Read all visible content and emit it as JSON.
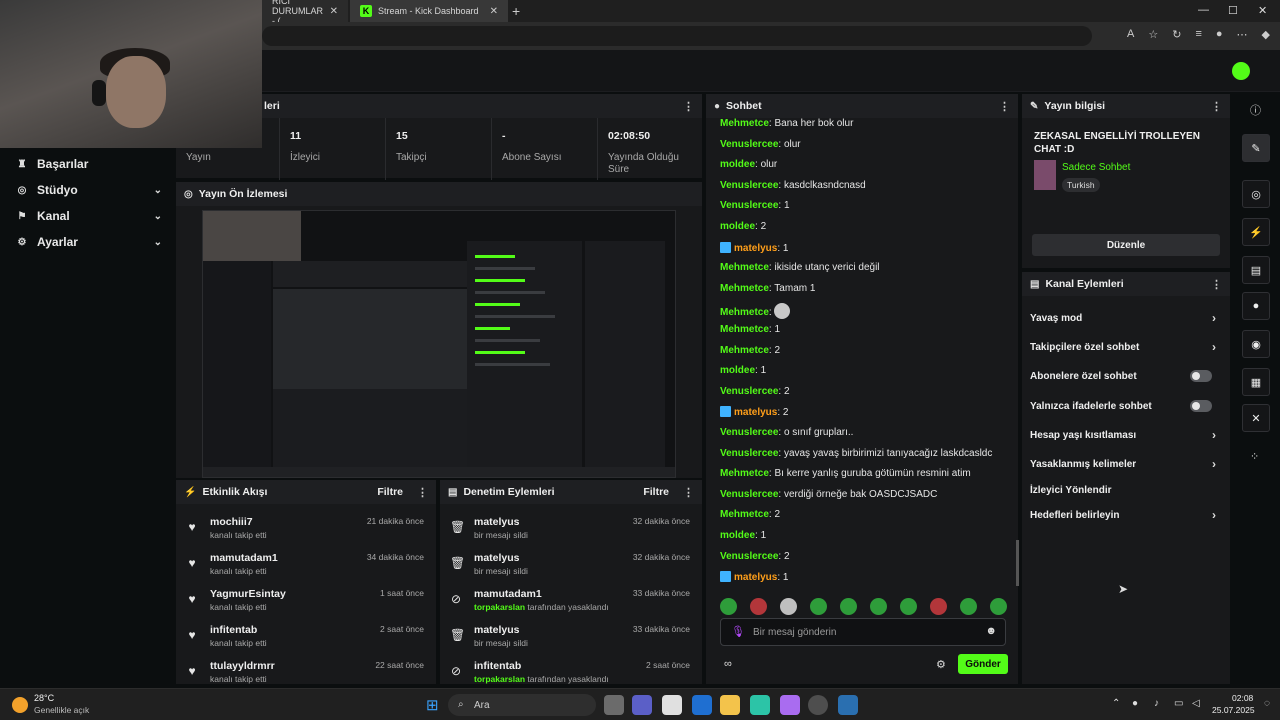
{
  "browser": {
    "tabs": [
      {
        "label": "RİCİ DURUMLAR - (",
        "close": "✕"
      },
      {
        "label": "Stream - Kick Dashboard",
        "close": "✕",
        "favicon": "K"
      }
    ],
    "new_tab": "+",
    "window_controls": [
      "—",
      "☐",
      "✕"
    ]
  },
  "nav": {
    "items": [
      {
        "label": "Başarılar",
        "icon": "trophy-icon"
      },
      {
        "label": "Stüdyo",
        "icon": "studio-icon",
        "chevron": "⌄"
      },
      {
        "label": "Kanal",
        "icon": "channel-icon",
        "chevron": "⌄"
      },
      {
        "label": "Ayarlar",
        "icon": "gear-icon",
        "chevron": "⌄"
      }
    ]
  },
  "stats": {
    "header": "leri",
    "items": [
      {
        "value": "",
        "label": "Yayın"
      },
      {
        "value": "11",
        "label": "İzleyici"
      },
      {
        "value": "15",
        "label": "Takipçi"
      },
      {
        "value": "-",
        "label": "Abone Sayısı"
      },
      {
        "value": "02:08:50",
        "label": "Yayında Olduğu Süre"
      }
    ]
  },
  "preview": {
    "title": "Yayın Ön İzlemesi"
  },
  "activity": {
    "title": "Etkinlik Akışı",
    "filter": "Filtre",
    "items": [
      {
        "name": "mochiii7",
        "action": "kanalı takip etti",
        "time": "21 dakika önce"
      },
      {
        "name": "mamutadam1",
        "action": "kanalı takip etti",
        "time": "34 dakika önce"
      },
      {
        "name": "YagmurEsintay",
        "action": "kanalı takip etti",
        "time": "1 saat önce"
      },
      {
        "name": "infitentab",
        "action": "kanalı takip etti",
        "time": "2 saat önce"
      },
      {
        "name": "ttulayyldrmrr",
        "action": "kanalı takip etti",
        "time": "22 saat önce"
      }
    ]
  },
  "moderation": {
    "title": "Denetim Eylemleri",
    "filter": "Filtre",
    "items": [
      {
        "name": "matelyus",
        "action": "bir mesajı sildi",
        "actor": "",
        "time": "32 dakika önce",
        "icon": "trash-icon"
      },
      {
        "name": "matelyus",
        "action": "bir mesajı sildi",
        "actor": "",
        "time": "32 dakika önce",
        "icon": "trash-icon"
      },
      {
        "name": "mamutadam1",
        "action": "tarafından yasaklandı",
        "actor": "torpakarslan",
        "time": "33 dakika önce",
        "icon": "ban-icon"
      },
      {
        "name": "matelyus",
        "action": "bir mesajı sildi",
        "actor": "",
        "time": "33 dakika önce",
        "icon": "trash-icon"
      },
      {
        "name": "infitentab",
        "action": "tarafından yasaklandı",
        "actor": "torpakarslan",
        "time": "2 saat önce",
        "icon": "ban-icon"
      }
    ]
  },
  "chat": {
    "title": "Sohbet",
    "messages": [
      {
        "user": "Mehmetce",
        "color": "#53fc18",
        "text": "Bana her bok olur"
      },
      {
        "user": "Venuslercee",
        "color": "#53fc18",
        "text": "olur"
      },
      {
        "user": "moldee",
        "color": "#53fc18",
        "text": "olur"
      },
      {
        "user": "Venuslercee",
        "color": "#53fc18",
        "text": "kasdclkasndcnasd"
      },
      {
        "user": "Venuslercee",
        "color": "#53fc18",
        "text": "1"
      },
      {
        "user": "moldee",
        "color": "#53fc18",
        "text": "2"
      },
      {
        "user": "matelyus",
        "color": "#ff9f1a",
        "text": "1",
        "badge": true
      },
      {
        "user": "Mehmetce",
        "color": "#53fc18",
        "text": "ikiside utanç verici değil"
      },
      {
        "user": "Mehmetce",
        "color": "#53fc18",
        "text": "Tamam 1"
      },
      {
        "user": "Mehmetce",
        "color": "#53fc18",
        "text": "",
        "emote": true
      },
      {
        "user": "Mehmetce",
        "color": "#53fc18",
        "text": "1"
      },
      {
        "user": "Mehmetce",
        "color": "#53fc18",
        "text": "2"
      },
      {
        "user": "moldee",
        "color": "#53fc18",
        "text": "1"
      },
      {
        "user": "Venuslercee",
        "color": "#53fc18",
        "text": "2"
      },
      {
        "user": "matelyus",
        "color": "#ff9f1a",
        "text": "2",
        "badge": true
      },
      {
        "user": "Venuslercee",
        "color": "#53fc18",
        "text": "o sınıf grupları.."
      },
      {
        "user": "Venuslercee",
        "color": "#53fc18",
        "text": "yavaş yavaş birbirimizi tanıyacağız laskdcasldc"
      },
      {
        "user": "Mehmetce",
        "color": "#53fc18",
        "text": "Bı kerre yanlış guruba götümün resmini atim"
      },
      {
        "user": "Venuslercee",
        "color": "#53fc18",
        "text": "verdiği örneğe bak OASDCJSADC"
      },
      {
        "user": "Mehmetce",
        "color": "#53fc18",
        "text": "2"
      },
      {
        "user": "moldee",
        "color": "#53fc18",
        "text": "1"
      },
      {
        "user": "Venuslercee",
        "color": "#53fc18",
        "text": "2"
      },
      {
        "user": "matelyus",
        "color": "#ff9f1a",
        "text": "1",
        "badge": true
      }
    ],
    "input_placeholder": "Bir mesaj gönderin",
    "send_label": "Gönder",
    "infinity": "∞"
  },
  "stream_info": {
    "title": "Yayın bilgisi",
    "stream_title": "ZEKASAL ENGELLİYİ TROLLEYEN CHAT :D",
    "category": "Sadece Sohbet",
    "language": "Turkish",
    "edit_label": "Düzenle"
  },
  "channel_actions": {
    "title": "Kanal Eylemleri",
    "items": [
      {
        "label": "Yavaş mod",
        "kind": "chevron"
      },
      {
        "label": "Takipçilere özel sohbet",
        "kind": "chevron"
      },
      {
        "label": "Abonelere özel sohbet",
        "kind": "toggle"
      },
      {
        "label": "Yalnızca ifadelerle sohbet",
        "kind": "toggle"
      },
      {
        "label": "Hesap yaşı kısıtlaması",
        "kind": "chevron"
      },
      {
        "label": "Yasaklanmış kelimeler",
        "kind": "chevron"
      },
      {
        "label": "İzleyici Yönlendir",
        "kind": "none"
      },
      {
        "label": "Hedefleri belirleyin",
        "kind": "chevron"
      }
    ]
  },
  "taskbar": {
    "weather_temp": "28°C",
    "weather_desc": "Genellikle açık",
    "search": "Ara",
    "time": "02:08",
    "date": "25.07.2025"
  },
  "colors": {
    "accent": "#53fc18",
    "panel": "#18191b",
    "background": "#0b0e0f"
  }
}
